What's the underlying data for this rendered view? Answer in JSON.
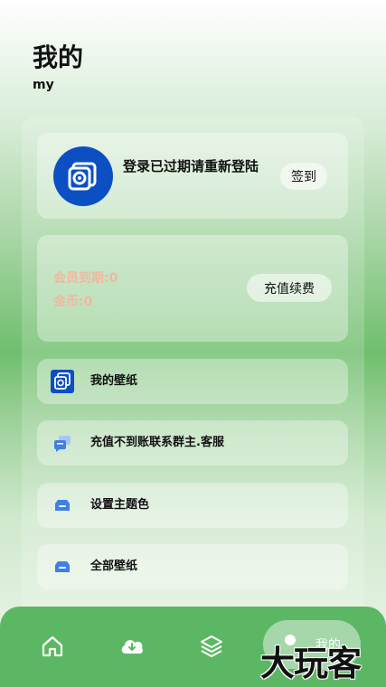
{
  "header": {
    "title": "我的",
    "subtitle": "my"
  },
  "profile": {
    "status_text": "登录已过期请重新登陆",
    "signin_label": "签到"
  },
  "membership": {
    "expiry_label": "会员到期:0",
    "coins_label": "金币:0",
    "recharge_label": "充值续费"
  },
  "menu": [
    {
      "label": "我的壁纸",
      "icon": "app-logo-icon"
    },
    {
      "label": "充值不到账联系群主.客服",
      "icon": "chat-icon"
    },
    {
      "label": "设置主题色",
      "icon": "tray-icon"
    },
    {
      "label": "全部壁纸",
      "icon": "tray-icon"
    }
  ],
  "tabbar": {
    "items": [
      {
        "icon": "home-icon"
      },
      {
        "icon": "cloud-download-icon"
      },
      {
        "icon": "layers-icon"
      },
      {
        "icon": "user-icon",
        "label": "我的",
        "active": true
      }
    ]
  },
  "watermark": {
    "text": "大玩客"
  },
  "colors": {
    "accent": "#5cb764",
    "avatar": "#0b4fc3",
    "member_text": "#f2b7a0",
    "menu_icon": "#3f7fe8"
  }
}
